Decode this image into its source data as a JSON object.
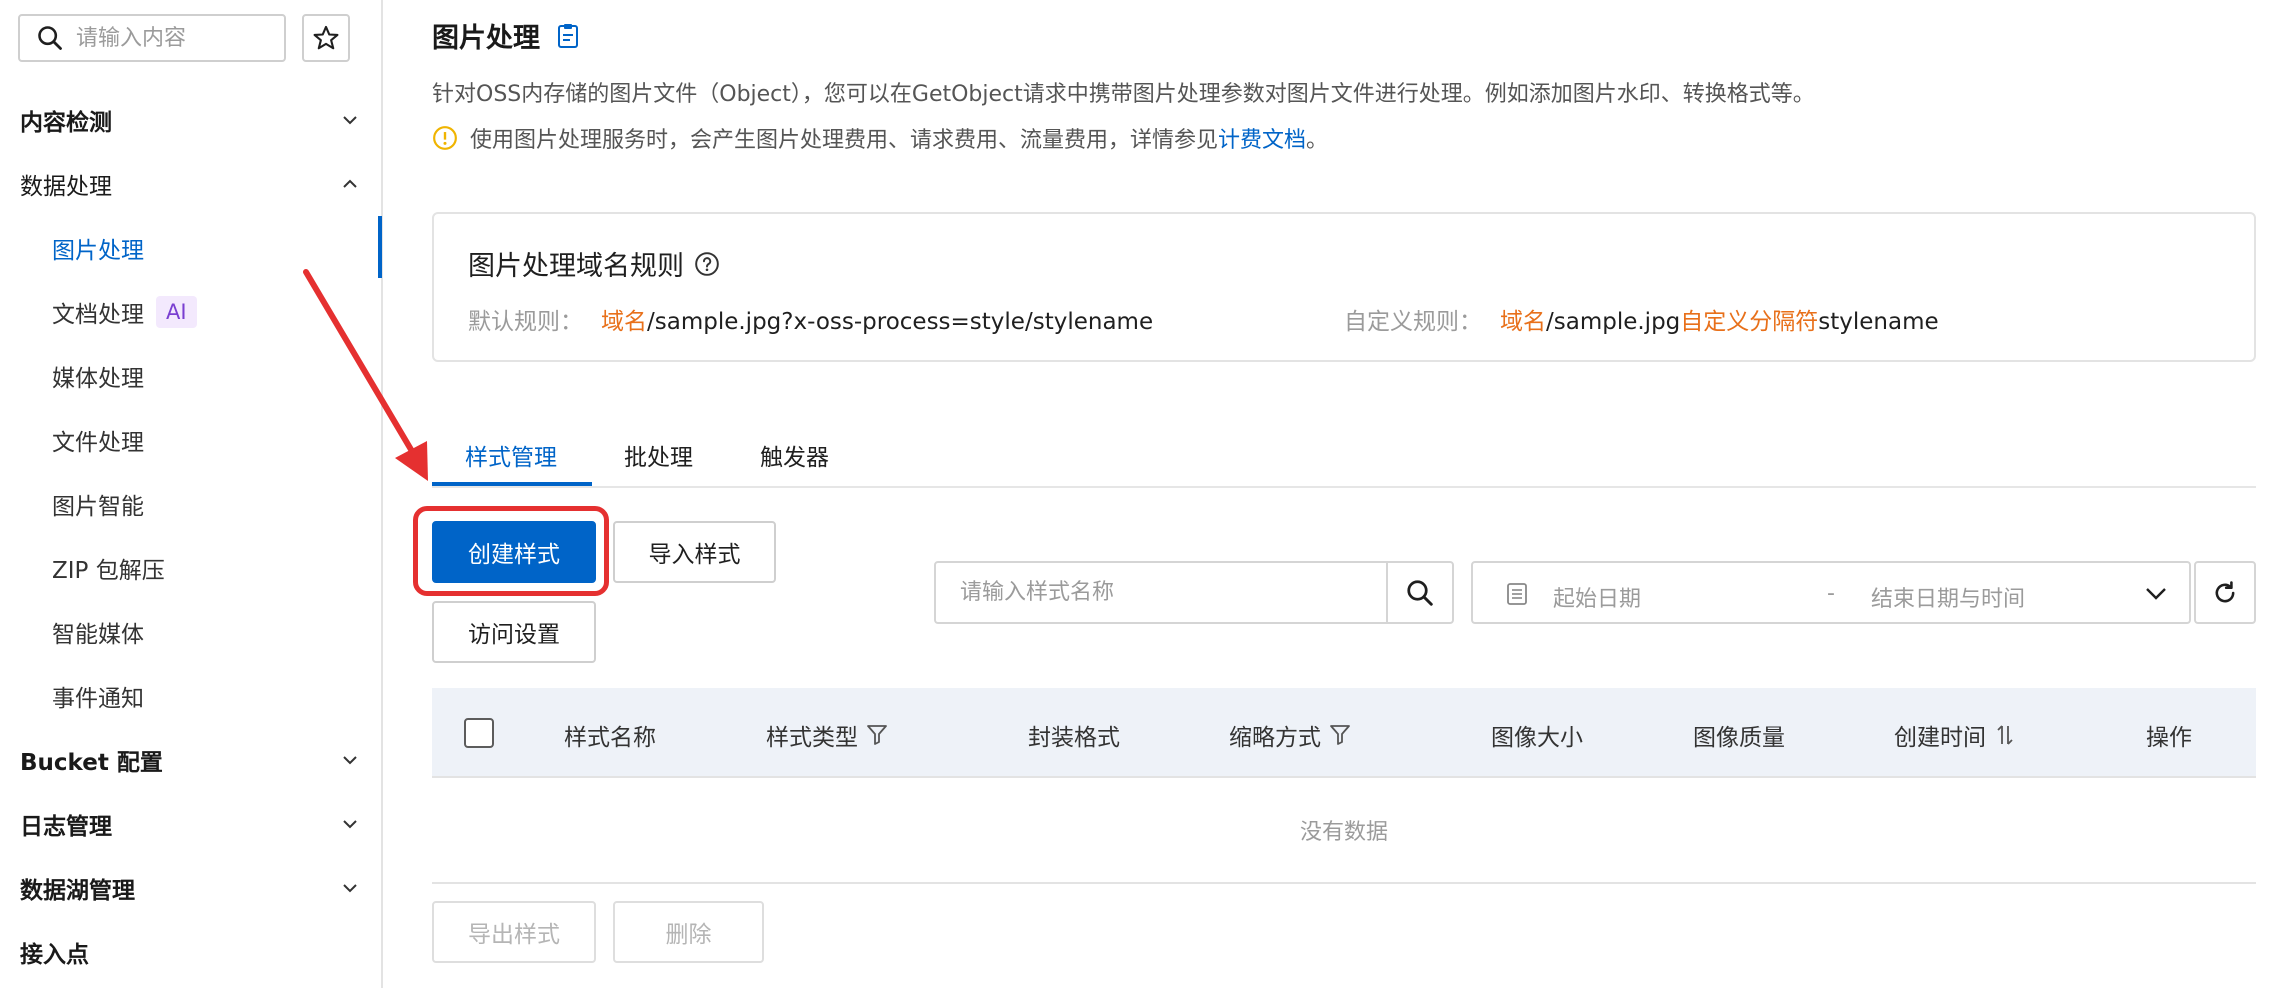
{
  "sidebar": {
    "search_placeholder": "请输入内容",
    "star_icon": "star-icon",
    "groups": [
      {
        "label": "内容检测"
      },
      {
        "label": "数据处理"
      },
      {
        "label": "Bucket 配置"
      },
      {
        "label": "日志管理"
      },
      {
        "label": "数据湖管理"
      },
      {
        "label": "接入点"
      }
    ],
    "items": [
      {
        "label": "图片处理",
        "active": true
      },
      {
        "label": "文档处理",
        "badge": "AI"
      },
      {
        "label": "媒体处理"
      },
      {
        "label": "文件处理"
      },
      {
        "label": "图片智能"
      },
      {
        "label": "ZIP 包解压"
      },
      {
        "label": "智能媒体"
      },
      {
        "label": "事件通知"
      }
    ]
  },
  "header": {
    "title": "图片处理",
    "description": "针对OSS内存储的图片文件（Object），您可以在GetObject请求中携带图片处理参数对图片文件进行处理。例如添加图片水印、转换格式等。",
    "notice_text": "使用图片处理服务时，会产生图片处理费用、请求费用、流量费用，详情参见",
    "notice_link": "计费文档",
    "notice_end": "。"
  },
  "rule_card": {
    "title": "图片处理域名规则",
    "default_label": "默认规则：",
    "default_domain": "域名",
    "default_path": "/sample.jpg?x-oss-process=style/stylename",
    "custom_label": "自定义规则：",
    "custom_domain": "域名",
    "custom_path": "/sample.jpg",
    "custom_separator": "自定义分隔符",
    "custom_suffix": "stylename"
  },
  "tabs": [
    {
      "label": "样式管理",
      "active": true
    },
    {
      "label": "批处理"
    },
    {
      "label": "触发器"
    }
  ],
  "toolbar": {
    "create_label": "创建样式",
    "import_label": "导入样式",
    "access_label": "访问设置",
    "style_search_placeholder": "请输入样式名称",
    "start_date_placeholder": "起始日期",
    "range_separator": "-",
    "end_date_placeholder": "结束日期与时间"
  },
  "table": {
    "columns": [
      "样式名称",
      "样式类型",
      "封装格式",
      "缩略方式",
      "图像大小",
      "图像质量",
      "创建时间",
      "操作"
    ],
    "empty_text": "没有数据"
  },
  "footer": {
    "export_label": "导出样式",
    "delete_label": "删除"
  },
  "colors": {
    "accent": "#0064c8",
    "highlight": "#e53030",
    "rule_highlight": "#e8701a"
  }
}
